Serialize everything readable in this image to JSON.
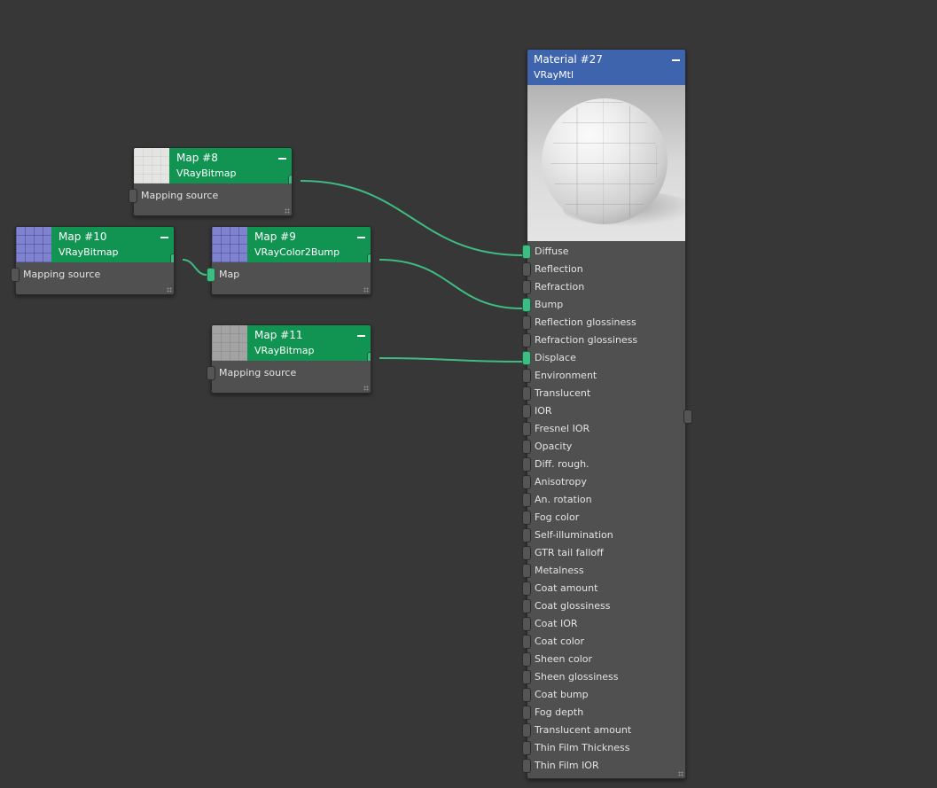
{
  "nodes": {
    "map8": {
      "title": "Map #8",
      "type": "VRayBitmap",
      "inputs": [
        "Mapping source"
      ]
    },
    "map10": {
      "title": "Map #10",
      "type": "VRayBitmap",
      "inputs": [
        "Mapping source"
      ]
    },
    "map9": {
      "title": "Map #9",
      "type": "VRayColor2Bump",
      "inputs": [
        "Map"
      ]
    },
    "map11": {
      "title": "Map #11",
      "type": "VRayBitmap",
      "inputs": [
        "Mapping source"
      ]
    },
    "material": {
      "title": "Material #27",
      "type": "VRayMtl",
      "inputs": [
        "Diffuse",
        "Reflection",
        "Refraction",
        "Bump",
        "Reflection glossiness",
        "Refraction glossiness",
        "Displace",
        "Environment",
        "Translucent",
        "IOR",
        "Fresnel IOR",
        "Opacity",
        "Diff. rough.",
        "Anisotropy",
        "An. rotation",
        "Fog color",
        "Self-illumination",
        "GTR tail falloff",
        "Metalness",
        "Coat amount",
        "Coat glossiness",
        "Coat IOR",
        "Coat color",
        "Sheen color",
        "Sheen glossiness",
        "Coat bump",
        "Fog depth",
        "Translucent amount",
        "Thin Film Thickness",
        "Thin Film IOR"
      ]
    }
  },
  "icons": {
    "minimize": "minimize-icon",
    "resize": "resize-grip-icon",
    "thumbnail": "texture-thumbnail"
  },
  "colors": {
    "canvas": "#373737",
    "node_body": "#505050",
    "map_header": "#119351",
    "material_header": "#3d64ad",
    "wire": "#3ebc81"
  }
}
